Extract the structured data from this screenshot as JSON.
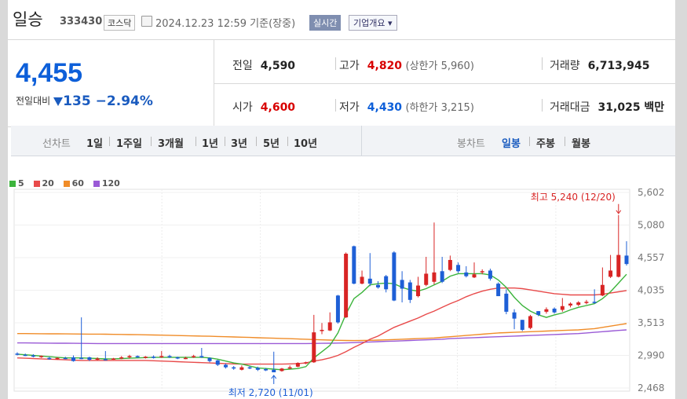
{
  "header": {
    "name": "일승",
    "code": "333430",
    "market": "코스닥",
    "datetime": "2024.12.23 12:59 기준(장중)",
    "realtime_label": "실시간",
    "company_info_label": "기업개요 ▾"
  },
  "summary": {
    "price": "4,455",
    "change_label": "전일대비",
    "change_amount": "135",
    "change_pct": "−2.94%",
    "prev_close_label": "전일",
    "prev_close": "4,590",
    "open_label": "시가",
    "open": "4,600",
    "high_label": "고가",
    "high": "4,820",
    "upper_limit": "(상한가 5,960)",
    "low_label": "저가",
    "low": "4,430",
    "lower_limit": "(하한가 3,215)",
    "volume_label": "거래량",
    "volume": "6,713,945",
    "amount_label": "거래대금",
    "amount": "31,025 백만"
  },
  "toolbar": {
    "line_chart_label": "선차트",
    "periods": [
      "1일",
      "1주일",
      "3개월",
      "1년",
      "3년",
      "5년",
      "10년"
    ],
    "candle_chart_label": "봉차트",
    "candle_periods": [
      "일봉",
      "주봉",
      "월봉"
    ],
    "candle_selected": "일봉"
  },
  "colors": {
    "up": "#d82424",
    "down": "#1e5fd6",
    "ma5": "#3cb43c",
    "ma20": "#e84a4a",
    "ma60": "#f08c28",
    "ma120": "#9a5ad6"
  },
  "chart_data": {
    "type": "candlestick",
    "legend": [
      "5",
      "20",
      "60",
      "120"
    ],
    "y_ticks": [
      "5,602",
      "5,080",
      "4,557",
      "4,035",
      "3,513",
      "2,990",
      "2,468"
    ],
    "ylim": [
      2468,
      5602
    ],
    "high_annotation": "최고 5,240 (12/20)",
    "low_annotation": "최저 2,720 (11/01)",
    "candles": [
      [
        3020,
        3000,
        3040,
        2990
      ],
      [
        3000,
        2990,
        3020,
        2980
      ],
      [
        2990,
        2970,
        3010,
        2960
      ],
      [
        2970,
        2980,
        2990,
        2950
      ],
      [
        2950,
        2930,
        2970,
        2920
      ],
      [
        2940,
        2950,
        2960,
        2920
      ],
      [
        2950,
        2940,
        2970,
        2930
      ],
      [
        2960,
        2900,
        2990,
        2890
      ],
      [
        2950,
        2940,
        3600,
        2930
      ],
      [
        2960,
        2920,
        2970,
        2900
      ],
      [
        2920,
        2940,
        2960,
        2910
      ],
      [
        2930,
        2920,
        3060,
        2910
      ],
      [
        2930,
        2940,
        2950,
        2920
      ],
      [
        2940,
        2960,
        2980,
        2930
      ],
      [
        2960,
        2980,
        3000,
        2940
      ],
      [
        2980,
        2960,
        2990,
        2950
      ],
      [
        2950,
        2970,
        2980,
        2940
      ],
      [
        2970,
        2950,
        2990,
        2940
      ],
      [
        2960,
        2980,
        3060,
        2950
      ],
      [
        2980,
        2960,
        3000,
        2950
      ],
      [
        2960,
        2940,
        2970,
        2930
      ],
      [
        2940,
        2950,
        2970,
        2930
      ],
      [
        2960,
        2980,
        3000,
        2950
      ],
      [
        2980,
        2960,
        3110,
        2950
      ],
      [
        2950,
        2900,
        2960,
        2880
      ],
      [
        2910,
        2840,
        2920,
        2820
      ],
      [
        2840,
        2800,
        2860,
        2780
      ],
      [
        2800,
        2780,
        2820,
        2760
      ],
      [
        2760,
        2800,
        2830,
        2750
      ],
      [
        2800,
        2790,
        2820,
        2770
      ],
      [
        2790,
        2760,
        2810,
        2740
      ],
      [
        2770,
        2750,
        2790,
        2740
      ],
      [
        2760,
        2720,
        3050,
        2720
      ],
      [
        2740,
        2780,
        2790,
        2730
      ],
      [
        2780,
        2800,
        2830,
        2770
      ],
      [
        2810,
        2870,
        2880,
        2800
      ],
      [
        2870,
        2880,
        2890,
        2850
      ],
      [
        2880,
        3360,
        3640,
        2870
      ],
      [
        3380,
        3400,
        3510,
        3330
      ],
      [
        3390,
        3520,
        3680,
        3380
      ],
      [
        3950,
        3520,
        3960,
        3500
      ],
      [
        3600,
        4620,
        4640,
        3590
      ],
      [
        4740,
        4140,
        4750,
        4130
      ],
      [
        4140,
        4250,
        4350,
        4130
      ],
      [
        4220,
        4140,
        4630,
        4100
      ],
      [
        4120,
        4080,
        4180,
        4060
      ],
      [
        4260,
        4050,
        4280,
        4000
      ],
      [
        4640,
        3870,
        4660,
        3860
      ],
      [
        4200,
        4060,
        4340,
        3840
      ],
      [
        4160,
        3880,
        4200,
        3830
      ],
      [
        3940,
        4110,
        4250,
        3920
      ],
      [
        4120,
        4300,
        4570,
        4100
      ],
      [
        4170,
        4320,
        5120,
        4130
      ],
      [
        4340,
        4170,
        4570,
        4150
      ],
      [
        4360,
        4520,
        4590,
        4340
      ],
      [
        4440,
        4340,
        4480,
        4310
      ],
      [
        4320,
        4260,
        4420,
        4240
      ],
      [
        4240,
        4290,
        4480,
        4230
      ],
      [
        4330,
        4340,
        4370,
        4290
      ],
      [
        4350,
        4220,
        4380,
        4190
      ],
      [
        4140,
        3940,
        4160,
        3940
      ],
      [
        3980,
        3690,
        4050,
        3650
      ],
      [
        3680,
        3580,
        3730,
        3410
      ],
      [
        3560,
        3400,
        3560,
        3380
      ],
      [
        3430,
        3620,
        3640,
        3410
      ],
      [
        3700,
        3640,
        3700,
        3620
      ],
      [
        3690,
        3730,
        3760,
        3660
      ],
      [
        3740,
        3680,
        3760,
        3660
      ],
      [
        3720,
        3780,
        3910,
        3690
      ],
      [
        3790,
        3820,
        3840,
        3760
      ],
      [
        3800,
        3840,
        3860,
        3780
      ],
      [
        3830,
        3850,
        3880,
        3810
      ],
      [
        3850,
        3830,
        4050,
        3820
      ],
      [
        3950,
        4120,
        4400,
        3940
      ],
      [
        4250,
        4350,
        4600,
        4230
      ],
      [
        4250,
        4600,
        5240,
        4240
      ],
      [
        4590,
        4455,
        4820,
        4430
      ]
    ],
    "ma5": [
      3010,
      3000,
      2990,
      2980,
      2970,
      2960,
      2950,
      2950,
      2950,
      2945,
      2940,
      2935,
      2935,
      2940,
      2945,
      2950,
      2955,
      2960,
      2960,
      2960,
      2960,
      2960,
      2960,
      2960,
      2950,
      2930,
      2900,
      2870,
      2850,
      2820,
      2790,
      2780,
      2770,
      2760,
      2770,
      2780,
      2810,
      2950,
      3050,
      3150,
      3350,
      3650,
      3900,
      4000,
      4120,
      4140,
      4150,
      4140,
      4080,
      4040,
      4020,
      4060,
      4120,
      4180,
      4260,
      4300,
      4300,
      4300,
      4300,
      4280,
      4200,
      4080,
      3920,
      3790,
      3700,
      3640,
      3600,
      3640,
      3670,
      3720,
      3760,
      3790,
      3820,
      3900,
      4010,
      4150,
      4290
    ],
    "ma20": [
      2950,
      2945,
      2940,
      2935,
      2930,
      2925,
      2920,
      2915,
      2910,
      2910,
      2910,
      2910,
      2910,
      2910,
      2910,
      2910,
      2910,
      2905,
      2900,
      2895,
      2890,
      2885,
      2880,
      2875,
      2870,
      2865,
      2860,
      2855,
      2850,
      2850,
      2850,
      2850,
      2850,
      2850,
      2855,
      2860,
      2870,
      2900,
      2920,
      2950,
      2990,
      3050,
      3120,
      3180,
      3250,
      3300,
      3370,
      3440,
      3490,
      3540,
      3590,
      3650,
      3700,
      3760,
      3820,
      3870,
      3930,
      3980,
      4020,
      4050,
      4070,
      4070,
      4070,
      4060,
      4040,
      4020,
      4000,
      3980,
      3970,
      3960,
      3960,
      3960,
      3960,
      3970,
      3990,
      4010,
      4030
    ],
    "ma60": [
      3340,
      3340,
      3339,
      3338,
      3337,
      3336,
      3335,
      3334,
      3333,
      3332,
      3331,
      3330,
      3328,
      3326,
      3324,
      3322,
      3320,
      3318,
      3315,
      3312,
      3309,
      3306,
      3303,
      3300,
      3297,
      3294,
      3290,
      3286,
      3282,
      3278,
      3274,
      3270,
      3266,
      3262,
      3258,
      3254,
      3250,
      3245,
      3240,
      3236,
      3232,
      3230,
      3228,
      3230,
      3232,
      3236,
      3240,
      3245,
      3250,
      3255,
      3260,
      3265,
      3270,
      3280,
      3290,
      3300,
      3310,
      3320,
      3330,
      3340,
      3350,
      3355,
      3360,
      3365,
      3370,
      3375,
      3380,
      3385,
      3390,
      3395,
      3400,
      3410,
      3420,
      3440,
      3460,
      3480,
      3500
    ],
    "ma120": [
      3190,
      3190,
      3189,
      3188,
      3187,
      3186,
      3185,
      3184,
      3183,
      3182,
      3181,
      3180,
      3180,
      3180,
      3180,
      3180,
      3180,
      3180,
      3180,
      3180,
      3180,
      3180,
      3180,
      3180,
      3180,
      3180,
      3180,
      3180,
      3180,
      3180,
      3180,
      3180,
      3180,
      3180,
      3180,
      3180,
      3180,
      3182,
      3184,
      3186,
      3188,
      3190,
      3195,
      3200,
      3205,
      3210,
      3215,
      3220,
      3225,
      3230,
      3235,
      3240,
      3245,
      3250,
      3260,
      3265,
      3270,
      3275,
      3280,
      3285,
      3290,
      3295,
      3300,
      3305,
      3310,
      3315,
      3320,
      3325,
      3330,
      3335,
      3340,
      3350,
      3360,
      3370,
      3380,
      3390,
      3400
    ]
  }
}
